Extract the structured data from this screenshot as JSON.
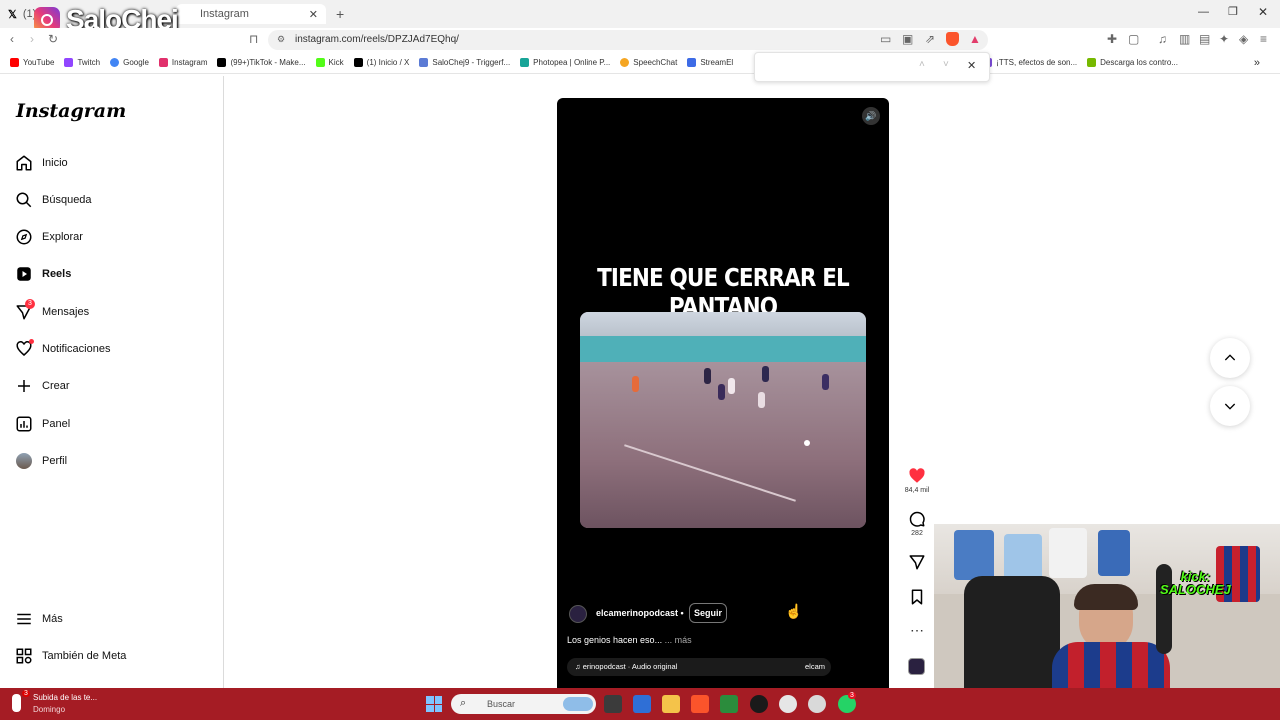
{
  "browser": {
    "tabs": [
      {
        "label": "(1) In"
      },
      {
        "label": "Instagram"
      }
    ],
    "new_tab": "+",
    "url": "instagram.com/reels/DPZJAd7EQhq/",
    "bookmarks": [
      {
        "label": "YouTube",
        "color": "#ff0000"
      },
      {
        "label": "Twitch",
        "color": "#9146ff"
      },
      {
        "label": "Google",
        "color": "#4285f4"
      },
      {
        "label": "Instagram",
        "color": "#e1306c"
      },
      {
        "label": "(99+)TikTok - Make...",
        "color": "#000000"
      },
      {
        "label": "Kick",
        "color": "#53fc18"
      },
      {
        "label": "(1) Inicio / X",
        "color": "#000000"
      },
      {
        "label": "SaloChej9 - Triggerf...",
        "color": "#5b7bd5"
      },
      {
        "label": "Photopea | Online P...",
        "color": "#18a497"
      },
      {
        "label": "SpeechChat",
        "color": "#f5a623"
      },
      {
        "label": "StreamEl",
        "color": "#3d6be6"
      },
      {
        "label": "¡TTS, efectos de son...",
        "color": "#7b4bd6"
      },
      {
        "label": "Descarga los contro...",
        "color": "#76b900"
      }
    ],
    "more_bookmarks": "»"
  },
  "overlay": {
    "streamer_logo": "SaloChej"
  },
  "sidebar": {
    "logo": "Instagram",
    "items": [
      {
        "label": "Inicio",
        "icon": "home-icon"
      },
      {
        "label": "Búsqueda",
        "icon": "search-icon"
      },
      {
        "label": "Explorar",
        "icon": "compass-icon"
      },
      {
        "label": "Reels",
        "icon": "reels-icon"
      },
      {
        "label": "Mensajes",
        "icon": "messages-icon",
        "badge": "3"
      },
      {
        "label": "Notificaciones",
        "icon": "heart-icon"
      },
      {
        "label": "Crear",
        "icon": "plus-icon"
      },
      {
        "label": "Panel",
        "icon": "dashboard-icon"
      },
      {
        "label": "Perfil",
        "icon": "avatar-icon"
      }
    ],
    "bottom": [
      {
        "label": "Más",
        "icon": "menu-icon"
      },
      {
        "label": "También de Meta",
        "icon": "meta-icon"
      }
    ]
  },
  "reel": {
    "title": "TIENE QUE CERRAR EL PANTANO",
    "author": "elcamerinopodcast",
    "follow": "Seguir",
    "caption": "Los genios hacen eso...",
    "more": "... más",
    "audio": "erinopodcast · Audio original",
    "audio_trail": "elcam",
    "likes": "84,4 mil",
    "comments": "282"
  },
  "webcam": {
    "overlay_text_1": "kick:",
    "overlay_text_2": "SALOCHEJ"
  },
  "taskbar": {
    "weather_title": "Subida de las te...",
    "weather_sub": "Domingo",
    "weather_badge": "3",
    "search_placeholder": "Buscar",
    "whatsapp_badge": "3"
  },
  "colors": {
    "like": "#ff3040",
    "badge": "#ff3040",
    "taskbar": "#a51c24"
  }
}
